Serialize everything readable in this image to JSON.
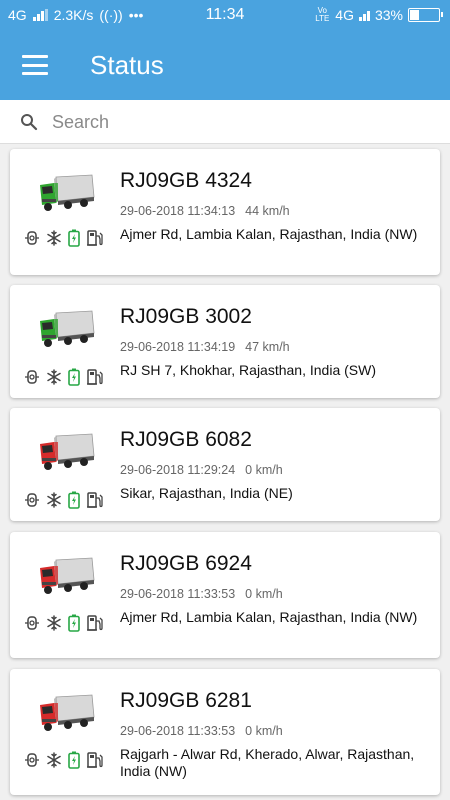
{
  "statusbar": {
    "network": "4G",
    "speed": "2.3K/s",
    "dots": "•••",
    "time": "11:34",
    "volte": "Vo LTE",
    "network_right": "4G",
    "battery": "33%",
    "battery_level": 0.33
  },
  "appbar": {
    "title": "Status"
  },
  "search": {
    "placeholder": "Search",
    "value": ""
  },
  "colors": {
    "primary": "#4aa3df",
    "truck_moving": "#2fa52f",
    "truck_stopped": "#d62b2b",
    "battery_icon": "#27a745"
  },
  "vehicles": [
    {
      "plate": "RJ09GB 4324",
      "datetime": "29-06-2018 11:34:13",
      "speed": "44 km/h",
      "address": "Ajmer Rd, Lambia Kalan, Rajasthan,  India (NW)",
      "status": "moving"
    },
    {
      "plate": "RJ09GB 3002",
      "datetime": "29-06-2018 11:34:19",
      "speed": "47 km/h",
      "address": "RJ SH 7,  Khokhar, Rajasthan,  India (SW)",
      "status": "moving"
    },
    {
      "plate": "RJ09GB 6082",
      "datetime": "29-06-2018 11:29:24",
      "speed": "0 km/h",
      "address": "Sikar, Rajasthan, India (NE)",
      "status": "stopped"
    },
    {
      "plate": "RJ09GB 6924",
      "datetime": "29-06-2018 11:33:53",
      "speed": "0 km/h",
      "address": "Ajmer Rd, Lambia Kalan, Rajasthan,  India (NW)",
      "status": "stopped"
    },
    {
      "plate": "RJ09GB 6281",
      "datetime": "29-06-2018 11:33:53",
      "speed": "0 km/h",
      "address": "Rajgarh - Alwar Rd,  Kherado,  Alwar, Rajasthan,  India (NW)",
      "status": "stopped"
    }
  ]
}
